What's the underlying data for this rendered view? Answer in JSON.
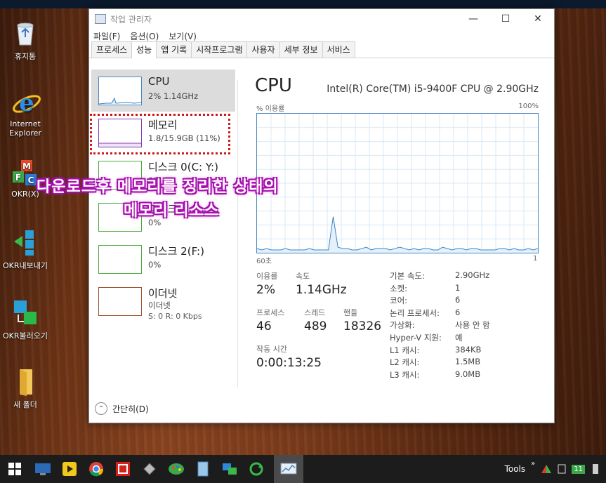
{
  "desktop": {
    "icons": [
      {
        "label": "휴지통"
      },
      {
        "label": "Internet Explorer"
      },
      {
        "label": "OKR(X)"
      },
      {
        "label": "OKR내보내기"
      },
      {
        "label": "OKR불러오기"
      },
      {
        "label": "새 폴더"
      }
    ]
  },
  "window": {
    "title": "작업 관리자",
    "menu": [
      "파일(F)",
      "옵션(O)",
      "보기(V)"
    ],
    "tabs": [
      "프로세스",
      "성능",
      "앱 기록",
      "시작프로그램",
      "사용자",
      "세부 정보",
      "서비스"
    ],
    "active_tab": "성능"
  },
  "sidebar": {
    "items": [
      {
        "name": "CPU",
        "value": "2% 1.14GHz",
        "extra": ""
      },
      {
        "name": "메모리",
        "value": "1.8/15.9GB (11%)",
        "extra": ""
      },
      {
        "name": "디스크 0(C: Y:)",
        "value": "0%",
        "extra": ""
      },
      {
        "name": "디스크 1",
        "value": "0%",
        "extra": ""
      },
      {
        "name": "디스크 2(F:)",
        "value": "0%",
        "extra": ""
      },
      {
        "name": "이더넷",
        "value": "이더넷",
        "extra": "S: 0  R: 0 Kbps"
      }
    ]
  },
  "detail": {
    "title": "CPU",
    "cpu_name": "Intel(R) Core(TM) i5-9400F CPU @ 2.90GHz",
    "graph_label_left": "% 이용률",
    "graph_label_right": "100%",
    "graph_bottom_left": "60초",
    "graph_bottom_right": "1",
    "stats": {
      "usage_label": "이용률",
      "usage": "2%",
      "speed_label": "속도",
      "speed": "1.14GHz",
      "processes_label": "프로세스",
      "processes": "46",
      "threads_label": "스레드",
      "threads": "489",
      "handles_label": "핸들",
      "handles": "18326",
      "uptime_label": "작동 시간",
      "uptime": "0:00:13:25"
    },
    "specs": [
      {
        "k": "기본 속도:",
        "v": "2.90GHz"
      },
      {
        "k": "소켓:",
        "v": "1"
      },
      {
        "k": "코어:",
        "v": "6"
      },
      {
        "k": "논리 프로세서:",
        "v": "6"
      },
      {
        "k": "가상화:",
        "v": "사용 안 함"
      },
      {
        "k": "Hyper-V 지원:",
        "v": "예"
      },
      {
        "k": "L1 캐시:",
        "v": "384KB"
      },
      {
        "k": "L2 캐시:",
        "v": "1.5MB"
      },
      {
        "k": "L3 캐시:",
        "v": "9.0MB"
      }
    ],
    "cpu_history": [
      3,
      2,
      3,
      2,
      2,
      2,
      3,
      2,
      2,
      2,
      2,
      3,
      2,
      2,
      2,
      2,
      26,
      4,
      3,
      3,
      2,
      2,
      3,
      4,
      2,
      3,
      3,
      3,
      2,
      3,
      4,
      3,
      2,
      3,
      2,
      3,
      3,
      2,
      2,
      4,
      3,
      2,
      3,
      3,
      2,
      3,
      3,
      2,
      2,
      2,
      2,
      3,
      3,
      2,
      3,
      2,
      2,
      3,
      2,
      3
    ]
  },
  "footer": {
    "label": "간단히(D)"
  },
  "overlay": {
    "line1": "다운로드후 메모리를 정리한 상태의",
    "line2": "메모리 리소스"
  },
  "taskbar": {
    "tools_label": "Tools",
    "badge": "11"
  }
}
